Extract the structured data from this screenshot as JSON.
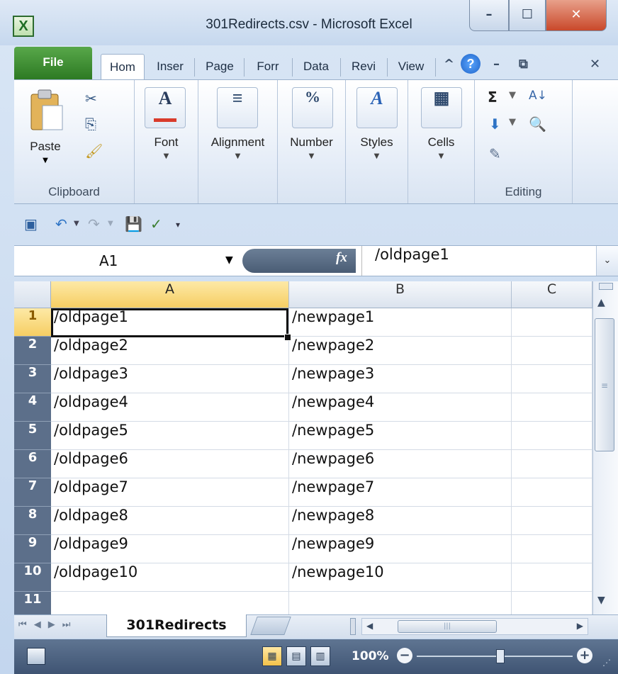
{
  "window": {
    "title": "301Redirects.csv  -  Microsoft Excel",
    "app_icon": "X",
    "controls": {
      "minimize": "–",
      "maximize": "☐",
      "close": "✕"
    }
  },
  "tabs": [
    {
      "label": "File"
    },
    {
      "label": "Hom"
    },
    {
      "label": "Inser"
    },
    {
      "label": "Page"
    },
    {
      "label": "Forr"
    },
    {
      "label": "Data"
    },
    {
      "label": "Revi"
    },
    {
      "label": "View"
    }
  ],
  "tab_controls": {
    "collapse": "^",
    "help": "?",
    "min": "–",
    "restore": "⧉",
    "close": "✕"
  },
  "ribbon": {
    "clipboard": {
      "paste": "Paste",
      "label": "Clipboard"
    },
    "font": {
      "label": "Font",
      "icon": "A"
    },
    "alignment": {
      "label": "Alignment",
      "icon": "≡"
    },
    "number": {
      "label": "Number",
      "icon": "%"
    },
    "styles": {
      "label": "Styles",
      "icon": "A"
    },
    "cells": {
      "label": "Cells",
      "icon": "▦"
    },
    "editing": {
      "label": "Editing",
      "sum": "Σ",
      "sort": "A↓",
      "find": "🔍"
    }
  },
  "formula_bar": {
    "name_box": "A1",
    "fx": "fx",
    "value": "/oldpage1"
  },
  "grid": {
    "columns": [
      "A",
      "B",
      "C"
    ],
    "selected_column": "A",
    "active_row": "1",
    "rows": [
      {
        "num": "1",
        "a": "/oldpage1",
        "b": "/newpage1"
      },
      {
        "num": "2",
        "a": "/oldpage2",
        "b": "/newpage2"
      },
      {
        "num": "3",
        "a": "/oldpage3",
        "b": "/newpage3"
      },
      {
        "num": "4",
        "a": "/oldpage4",
        "b": "/newpage4"
      },
      {
        "num": "5",
        "a": "/oldpage5",
        "b": "/newpage5"
      },
      {
        "num": "6",
        "a": "/oldpage6",
        "b": "/newpage6"
      },
      {
        "num": "7",
        "a": "/oldpage7",
        "b": "/newpage7"
      },
      {
        "num": "8",
        "a": "/oldpage8",
        "b": "/newpage8"
      },
      {
        "num": "9",
        "a": "/oldpage9",
        "b": "/newpage9"
      },
      {
        "num": "10",
        "a": "/oldpage10",
        "b": "/newpage10"
      },
      {
        "num": "11",
        "a": "",
        "b": ""
      }
    ]
  },
  "sheet_tabs": {
    "active": "301Redirects"
  },
  "status": {
    "zoom": "100%"
  },
  "colors": {
    "file_tab": "#2d7a23",
    "selected_header": "#f6ce63",
    "status_bar": "#4a5f7e"
  }
}
